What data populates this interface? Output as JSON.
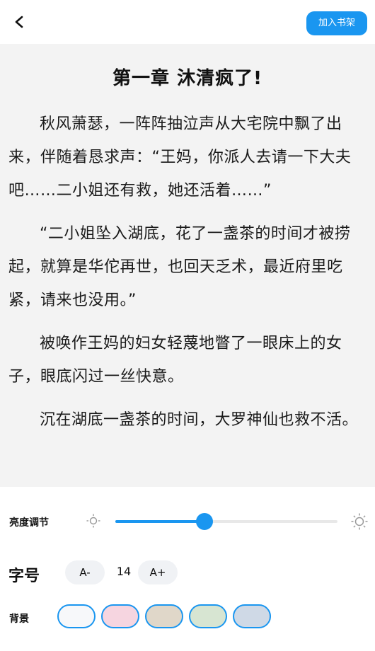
{
  "header": {
    "back_icon": "chevron-left-icon",
    "add_to_shelf_label": "加入书架"
  },
  "reader": {
    "chapter_title": "第一章  沐清疯了!",
    "paragraphs": [
      "秋风萧瑟，一阵阵抽泣声从大宅院中飘了出来，伴随着恳求声：“王妈，你派人去请一下大夫吧……二小姐还有救，她还活着……”",
      "“二小姐坠入湖底，花了一盏茶的时间才被捞起，就算是华佗再世，也回天乏术，最近府里吃紧，请来也没用。”",
      "被唤作王妈的妇女轻蔑地瞥了一眼床上的女子，眼底闪过一丝快意。",
      "沉在湖底一盏茶的时间，大罗神仙也救不活。"
    ],
    "background_color": "#f3f3f3"
  },
  "settings": {
    "brightness_label": "亮度调节",
    "brightness_level": 0.4,
    "brightness_low_icon": "sun-small-icon",
    "brightness_high_icon": "sun-large-icon",
    "font_label": "字号",
    "font_decrease_label": "A-",
    "font_size_value": "14",
    "font_increase_label": "A+",
    "background_label": "背景",
    "background_swatches": [
      "#f7f8fa",
      "#f6d5e0",
      "#e0d7c9",
      "#d7e5d2",
      "#cfd9e6"
    ],
    "accent_color": "#1a96f0"
  }
}
